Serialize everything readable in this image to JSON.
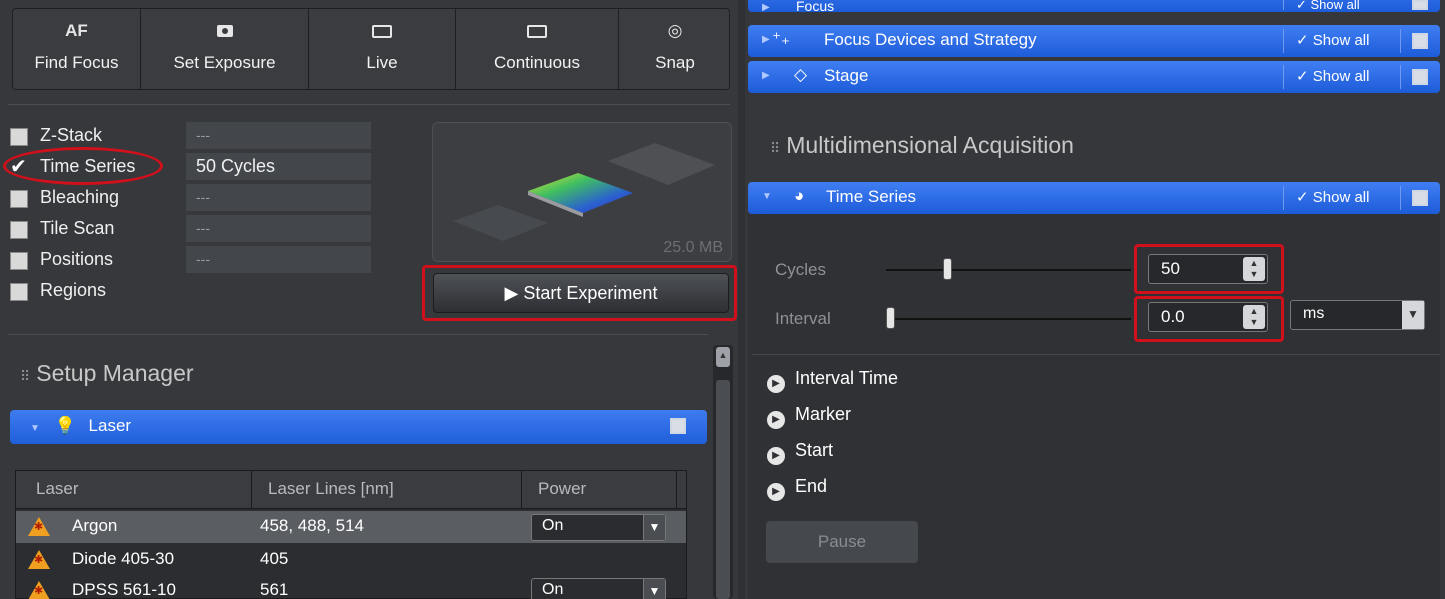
{
  "toolbar": {
    "buttons": [
      {
        "icon_text": "AF",
        "label": "Find Focus"
      },
      {
        "icon": "camera-icon",
        "label": "Set Exposure"
      },
      {
        "icon": "video-icon",
        "label": "Live"
      },
      {
        "icon": "video-icon",
        "label": "Continuous"
      },
      {
        "icon": "camera-outline-icon",
        "label": "Snap"
      }
    ]
  },
  "experiment": {
    "rows": [
      {
        "label": "Z-Stack",
        "checked": false,
        "value": "---"
      },
      {
        "label": "Time Series",
        "checked": true,
        "value": "50 Cycles"
      },
      {
        "label": "Bleaching",
        "checked": false,
        "value": "---"
      },
      {
        "label": "Tile Scan",
        "checked": false,
        "value": "---"
      },
      {
        "label": "Positions",
        "checked": false,
        "value": "---"
      },
      {
        "label": "Regions",
        "checked": false,
        "value": ""
      }
    ],
    "preview_size": "25.0 MB",
    "start_button": "Start Experiment"
  },
  "setup_manager": {
    "title": "Setup Manager",
    "laser": {
      "header": "Laser",
      "columns": [
        "Laser",
        "Laser Lines [nm]",
        "Power"
      ],
      "rows": [
        {
          "name": "Argon",
          "lines": "458, 488, 514",
          "power": "On"
        },
        {
          "name": "Diode 405-30",
          "lines": "405",
          "power": ""
        },
        {
          "name": "DPSS 561-10",
          "lines": "561",
          "power": "On"
        }
      ]
    }
  },
  "right": {
    "top_sections": [
      {
        "label": "Focus",
        "show_all": "Show all"
      },
      {
        "label": "Focus Devices and Strategy",
        "show_all": "Show all"
      },
      {
        "label": "Stage",
        "show_all": "Show all"
      }
    ],
    "mda_title": "Multidimensional Acquisition",
    "time_series": {
      "header": "Time Series",
      "show_all": "Show all",
      "cycles_label": "Cycles",
      "cycles_value": "50",
      "interval_label": "Interval",
      "interval_value": "0.0",
      "interval_unit": "ms",
      "sub_sections": [
        "Interval Time",
        "Marker",
        "Start",
        "End"
      ],
      "pause_button": "Pause"
    }
  },
  "colors": {
    "accent_blue": "#2a66e0",
    "highlight_red": "#d0101a",
    "panel_dark": "#35373b"
  }
}
